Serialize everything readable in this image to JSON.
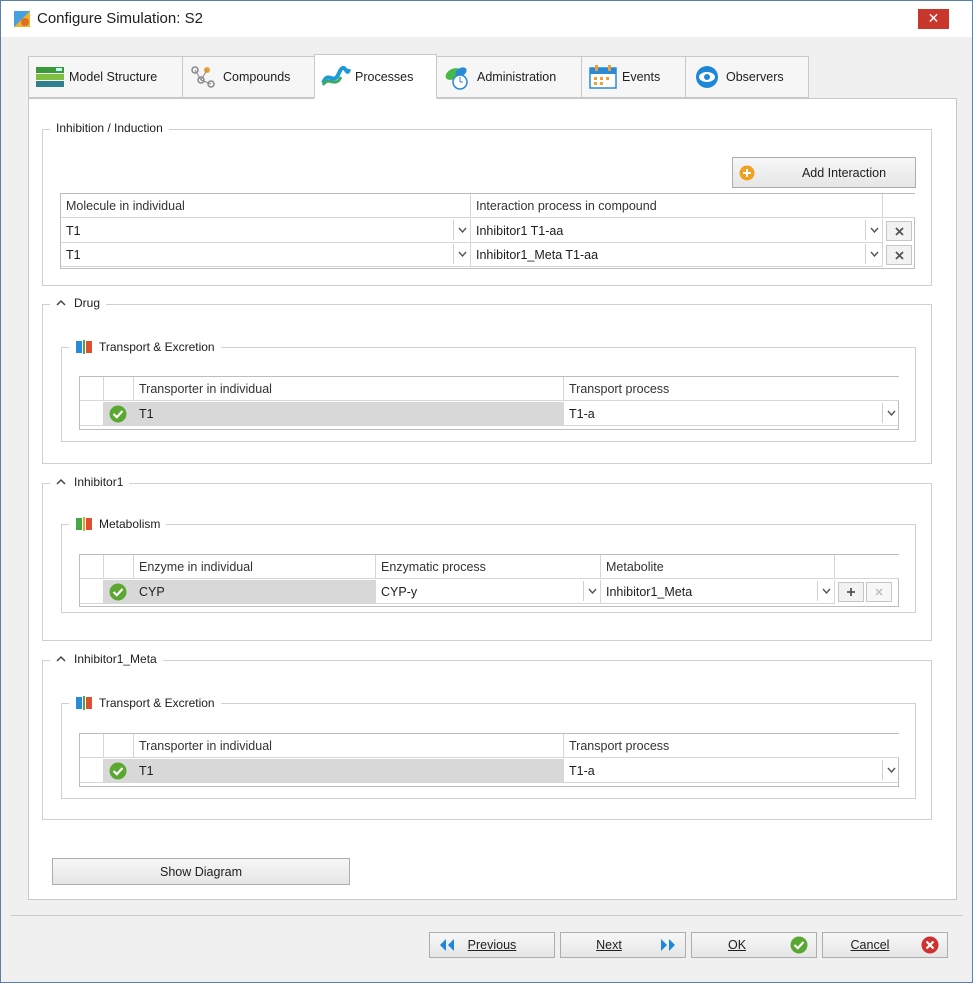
{
  "window": {
    "title": "Configure Simulation: S2",
    "close_glyph": "✕"
  },
  "tabs": [
    {
      "label": "Model Structure",
      "icon": "model-structure-icon"
    },
    {
      "label": "Compounds",
      "icon": "compounds-icon"
    },
    {
      "label": "Processes",
      "icon": "processes-icon",
      "active": true
    },
    {
      "label": "Administration",
      "icon": "administration-icon"
    },
    {
      "label": "Events",
      "icon": "events-icon"
    },
    {
      "label": "Observers",
      "icon": "observers-icon"
    }
  ],
  "inhibition": {
    "title": "Inhibition / Induction",
    "add_button": "Add Interaction",
    "col_molecule": "Molecule in individual",
    "col_process": "Interaction process in compound",
    "rows": [
      {
        "molecule": "T1",
        "process": "Inhibitor1 T1-aa"
      },
      {
        "molecule": "T1",
        "process": "Inhibitor1_Meta T1-aa"
      }
    ]
  },
  "drug": {
    "title": "Drug",
    "sub_title": "Transport & Excretion",
    "col_a": "Transporter in individual",
    "col_b": "Transport process",
    "row": {
      "a": "T1",
      "b": "T1-a"
    }
  },
  "inhibitor1": {
    "title": "Inhibitor1",
    "sub_title": "Metabolism",
    "col_a": "Enzyme in individual",
    "col_b": "Enzymatic process",
    "col_c": "Metabolite",
    "row": {
      "a": "CYP",
      "b": "CYP-y",
      "c": "Inhibitor1_Meta"
    }
  },
  "inhibitor1_meta": {
    "title": "Inhibitor1_Meta",
    "sub_title": "Transport & Excretion",
    "col_a": "Transporter in individual",
    "col_b": "Transport process",
    "row": {
      "a": "T1",
      "b": "T1-a"
    }
  },
  "show_diagram": "Show Diagram",
  "footer": {
    "previous": "Previous",
    "next": "Next",
    "ok": "OK",
    "cancel": "Cancel"
  },
  "colors": {
    "accent": "#1e88d8",
    "success": "#5aa832",
    "danger": "#c9372c"
  }
}
